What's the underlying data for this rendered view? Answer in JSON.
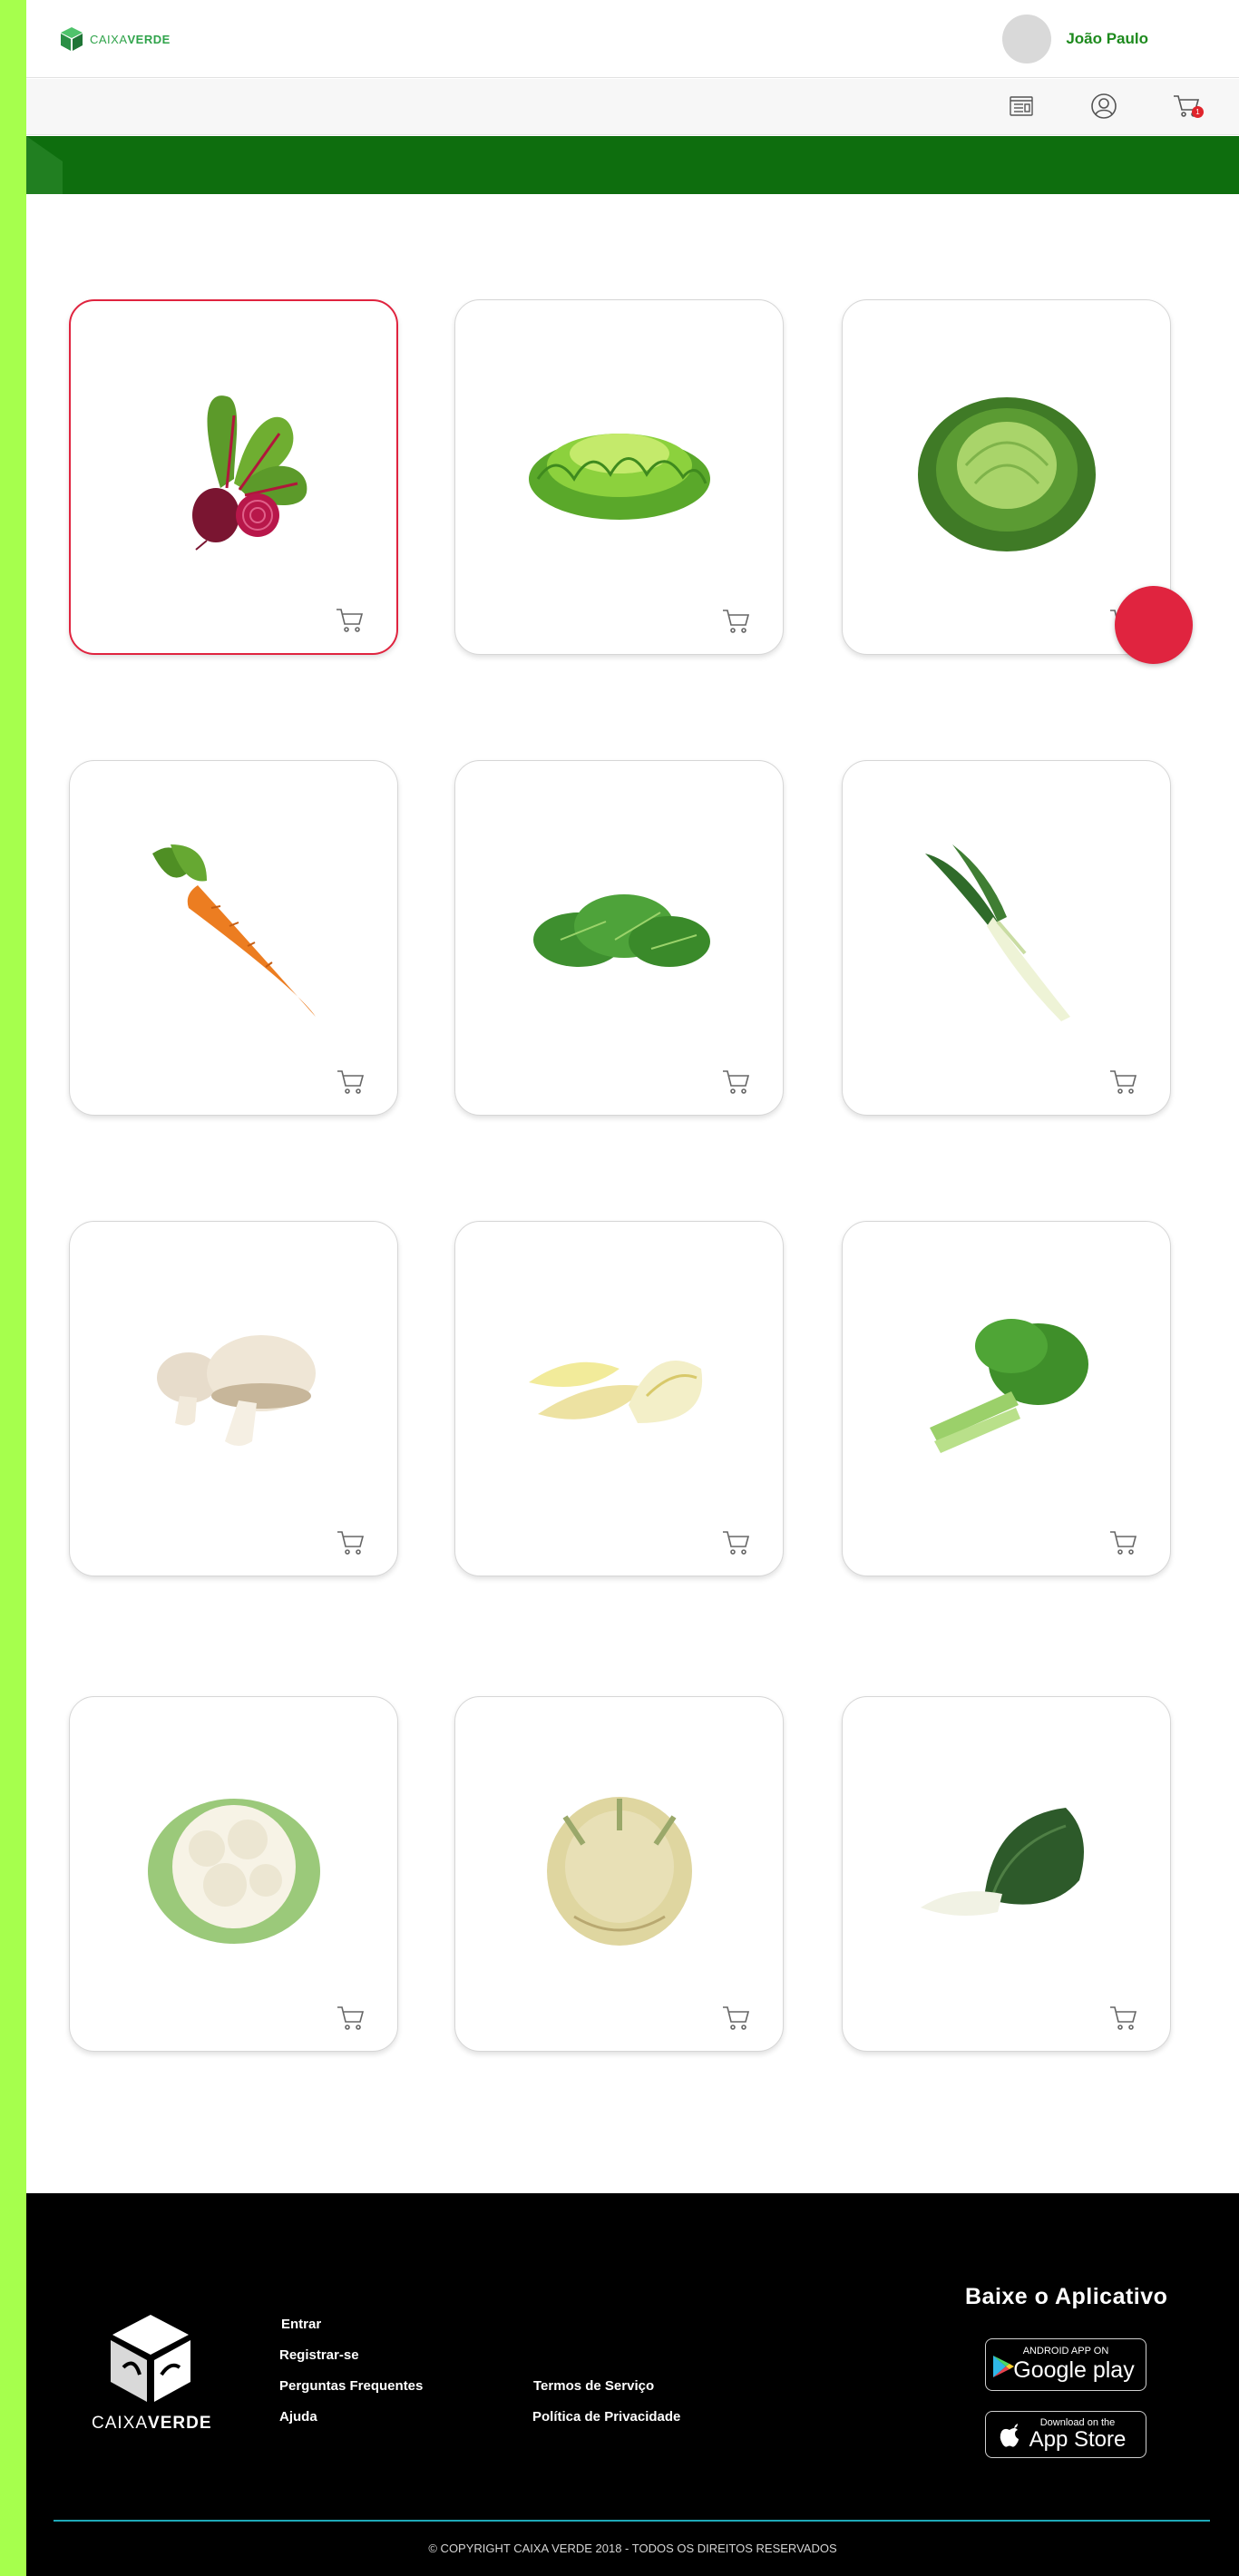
{
  "brand": {
    "name_light": "CAIXA",
    "name_bold": "VERDE",
    "primary_green": "#1d8a1d",
    "banner_green": "#0e6e0e",
    "accent_red": "#e0243f",
    "side_strip": "#a6ff4d"
  },
  "header": {
    "user_name": "João Paulo",
    "icons": [
      "news-icon",
      "profile-icon",
      "cart-icon"
    ],
    "cart_count": "1"
  },
  "products": [
    {
      "name": "beetroot",
      "selected": true
    },
    {
      "name": "lettuce"
    },
    {
      "name": "cabbage"
    },
    {
      "name": "carrot"
    },
    {
      "name": "arugula"
    },
    {
      "name": "leek"
    },
    {
      "name": "mushroom"
    },
    {
      "name": "endive"
    },
    {
      "name": "celery"
    },
    {
      "name": "cauliflower"
    },
    {
      "name": "celeriac"
    },
    {
      "name": "chard"
    }
  ],
  "footer": {
    "links": {
      "entrar": "Entrar",
      "registrar": "Registrar-se",
      "faq": "Perguntas Frequentes",
      "ajuda": "Ajuda",
      "termos": "Termos de Serviço",
      "privacidade": "Política de Privacidade"
    },
    "app_title": "Baixe o Aplicativo",
    "google_small": "ANDROID APP ON",
    "google_big": "Google play",
    "apple_small": "Download on the",
    "apple_big": "App Store",
    "copyright": "© COPYRIGHT CAIXA VERDE 2018 - TODOS OS DIREITOS RESERVADOS"
  }
}
